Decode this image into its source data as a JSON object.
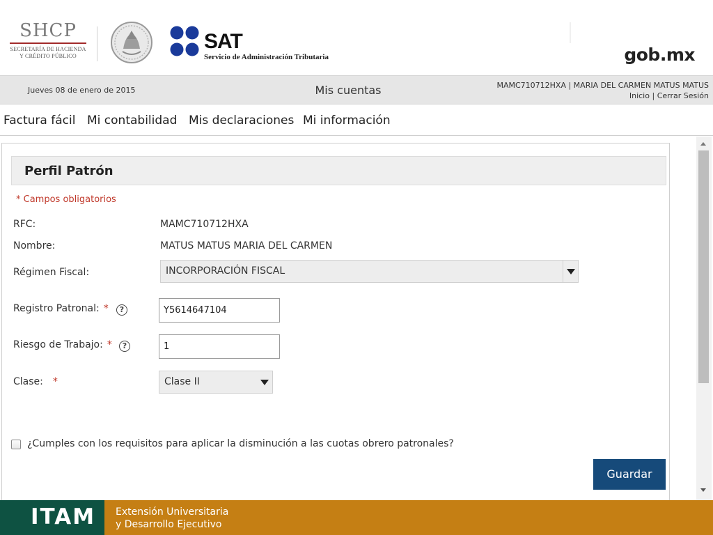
{
  "header": {
    "shcp": {
      "title": "SHCP",
      "subtitle_line1": "SECRETARÍA DE HACIENDA",
      "subtitle_line2": "Y CRÉDITO PÚBLICO"
    },
    "sat": {
      "title": "SAT",
      "subtitle": "Servicio de Administración Tributaria"
    },
    "gob": "gob.mx"
  },
  "info_bar": {
    "date": "Jueves 08 de enero de 2015",
    "title": "Mis cuentas",
    "user": "MAMC710712HXA | MARIA DEL CARMEN MATUS MATUS",
    "home_link": "Inicio",
    "separator": "|",
    "logout_link": "Cerrar Sesión"
  },
  "nav": {
    "items": [
      {
        "label": "Factura fácil"
      },
      {
        "label": "Mi contabilidad"
      },
      {
        "label": "Mis declaraciones"
      },
      {
        "label": "Mi información"
      }
    ]
  },
  "form": {
    "title": "Perfil Patrón",
    "required_note": "* Campos obligatorios",
    "required_marker": "*",
    "help_glyph": "?",
    "rfc": {
      "label": "RFC:",
      "value": "MAMC710712HXA"
    },
    "nombre": {
      "label": "Nombre:",
      "value": "MATUS MATUS MARIA DEL CARMEN"
    },
    "regimen": {
      "label": "Régimen Fiscal:",
      "value": "INCORPORACIÓN FISCAL"
    },
    "registro": {
      "label": "Registro Patronal:",
      "value": "Y5614647104"
    },
    "riesgo": {
      "label": "Riesgo de Trabajo:",
      "value": "1"
    },
    "clase": {
      "label": "Clase:",
      "value": "Clase II"
    },
    "checkbox": {
      "label": "¿Cumples con los requisitos para aplicar la disminución a las cuotas obrero patronales?",
      "checked": false
    },
    "save_label": "Guardar"
  },
  "footer": {
    "logo": "ITAM",
    "line1": "Extensión Universitaria",
    "line2": "y Desarrollo Ejecutivo"
  },
  "colors": {
    "primary_button": "#164a7a",
    "required": "#c0392b",
    "footer_bg": "#c57f14",
    "footer_logo_bg": "#0e5242",
    "sat_blue": "#1a3a9a"
  },
  "icons": {
    "help": "question-circle-icon",
    "dropdown": "caret-down-icon",
    "seal": "coat-of-arms-seal-icon",
    "sat_dots": "sat-logo-dots-icon"
  }
}
